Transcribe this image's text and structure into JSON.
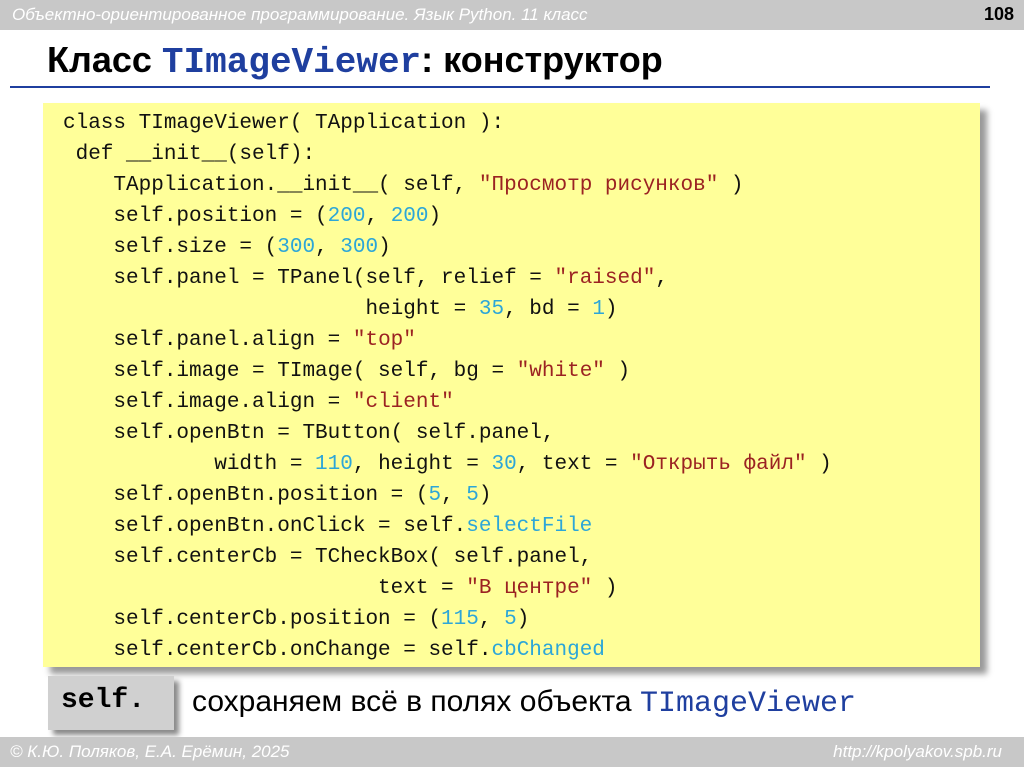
{
  "header": {
    "course": "Объектно-ориентированное программирование. Язык Python. 11 класс",
    "page_number": "108"
  },
  "title": {
    "prefix": "Класс ",
    "class_name": "TImageViewer",
    "suffix": ": конструктор"
  },
  "code": {
    "lines": [
      [
        {
          "t": "class TImageViewer( TApplication ):"
        }
      ],
      [
        {
          "t": " def __init__(self):"
        }
      ],
      [
        {
          "t": "    TApplication.__init__( self, "
        },
        {
          "t": "\"Просмотр рисунков\"",
          "c": "str"
        },
        {
          "t": " )"
        }
      ],
      [
        {
          "t": "    self.position = ("
        },
        {
          "t": "200",
          "c": "num"
        },
        {
          "t": ", "
        },
        {
          "t": "200",
          "c": "num"
        },
        {
          "t": ")"
        }
      ],
      [
        {
          "t": "    self.size = ("
        },
        {
          "t": "300",
          "c": "num"
        },
        {
          "t": ", "
        },
        {
          "t": "300",
          "c": "num"
        },
        {
          "t": ")"
        }
      ],
      [
        {
          "t": "    self.panel = TPanel(self, relief = "
        },
        {
          "t": "\"raised\"",
          "c": "str"
        },
        {
          "t": ","
        }
      ],
      [
        {
          "t": "                        height = "
        },
        {
          "t": "35",
          "c": "num"
        },
        {
          "t": ", bd = "
        },
        {
          "t": "1",
          "c": "num"
        },
        {
          "t": ")"
        }
      ],
      [
        {
          "t": "    self.panel.align = "
        },
        {
          "t": "\"top\"",
          "c": "str"
        }
      ],
      [
        {
          "t": "    self.image = TImage( self, bg = "
        },
        {
          "t": "\"white\"",
          "c": "str"
        },
        {
          "t": " )"
        }
      ],
      [
        {
          "t": "    self.image.align = "
        },
        {
          "t": "\"client\"",
          "c": "str"
        }
      ],
      [
        {
          "t": "    self.openBtn = TButton( self.panel,"
        }
      ],
      [
        {
          "t": "            width = "
        },
        {
          "t": "110",
          "c": "num"
        },
        {
          "t": ", height = "
        },
        {
          "t": "30",
          "c": "num"
        },
        {
          "t": ", text = "
        },
        {
          "t": "\"Открыть файл\"",
          "c": "str"
        },
        {
          "t": " )"
        }
      ],
      [
        {
          "t": "    self.openBtn.position = ("
        },
        {
          "t": "5",
          "c": "num"
        },
        {
          "t": ", "
        },
        {
          "t": "5",
          "c": "num"
        },
        {
          "t": ")"
        }
      ],
      [
        {
          "t": "    self.openBtn.onClick = self."
        },
        {
          "t": "selectFile",
          "c": "attr"
        }
      ],
      [
        {
          "t": "    self.centerCb = TCheckBox( self.panel,"
        }
      ],
      [
        {
          "t": "                         text = "
        },
        {
          "t": "\"В центре\"",
          "c": "str"
        },
        {
          "t": " )"
        }
      ],
      [
        {
          "t": "    self.centerCb.position = ("
        },
        {
          "t": "115",
          "c": "num"
        },
        {
          "t": ", "
        },
        {
          "t": "5",
          "c": "num"
        },
        {
          "t": ")"
        }
      ],
      [
        {
          "t": "    self.centerCb.onChange = self."
        },
        {
          "t": "cbChanged",
          "c": "attr"
        }
      ]
    ]
  },
  "note": {
    "keyword": "self.",
    "text": "сохраняем всё в полях объекта ",
    "class_name": "TImageViewer"
  },
  "footer": {
    "author": "© К.Ю. Поляков, Е.А. Ерёмин, 2025",
    "url": "http://kpolyakov.spb.ru"
  },
  "colors": {
    "code_background": "#ffff99",
    "accent_blue": "#1f3f9f",
    "number": "#2ca6d8",
    "string": "#9b2222",
    "bars": "#c8c8c8"
  }
}
